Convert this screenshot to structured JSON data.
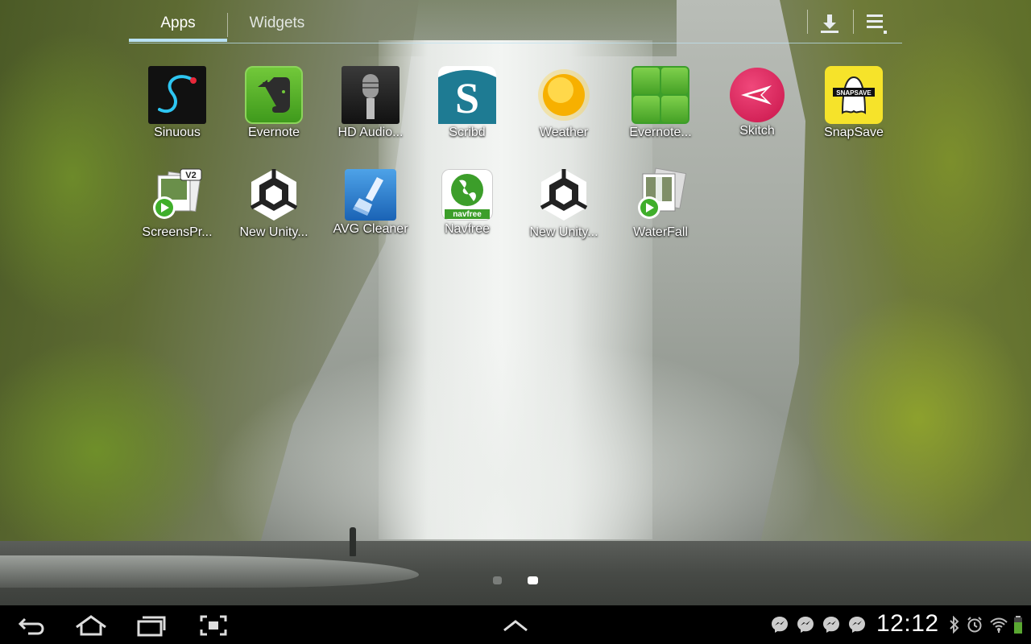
{
  "tabs": {
    "apps_label": "Apps",
    "widgets_label": "Widgets"
  },
  "toolbar_icons": [
    "download-icon",
    "menu-icon"
  ],
  "apps": [
    {
      "label": "Sinuous",
      "icon": "sinuous-icon"
    },
    {
      "label": "Evernote",
      "icon": "evernote-icon"
    },
    {
      "label": "HD Audio...",
      "icon": "microphone-icon"
    },
    {
      "label": "Scribd",
      "icon": "scribd-icon"
    },
    {
      "label": "Weather",
      "icon": "sun-icon"
    },
    {
      "label": "Evernote...",
      "icon": "evernote-widget-icon"
    },
    {
      "label": "Skitch",
      "icon": "skitch-icon"
    },
    {
      "label": "SnapSave",
      "icon": "snapsave-icon"
    },
    {
      "label": "ScreensPr...",
      "icon": "screenspresso-icon"
    },
    {
      "label": "New Unity...",
      "icon": "unity-icon"
    },
    {
      "label": "AVG Cleaner",
      "icon": "avg-cleaner-icon"
    },
    {
      "label": "Navfree",
      "icon": "navfree-icon"
    },
    {
      "label": "New Unity...",
      "icon": "unity-icon"
    },
    {
      "label": "WaterFall",
      "icon": "waterfall-icon"
    }
  ],
  "icon_text": {
    "scribd_letter": "S",
    "snapsave_badge": "SNAPSAVE",
    "navfree_brand": "navfree",
    "screenspresso_badge": "V2"
  },
  "pager": {
    "pages": 2,
    "current": 2
  },
  "status": {
    "time": "12:12",
    "notifications": [
      "messenger-icon",
      "messenger-icon",
      "messenger-icon",
      "messenger-icon"
    ],
    "system_icons": [
      "bluetooth-icon",
      "alarm-icon",
      "wifi-icon",
      "battery-icon"
    ]
  },
  "colors": {
    "tab_indicator": "#b9e2f5",
    "navbar": "#000000",
    "label_text": "#ffffff"
  }
}
